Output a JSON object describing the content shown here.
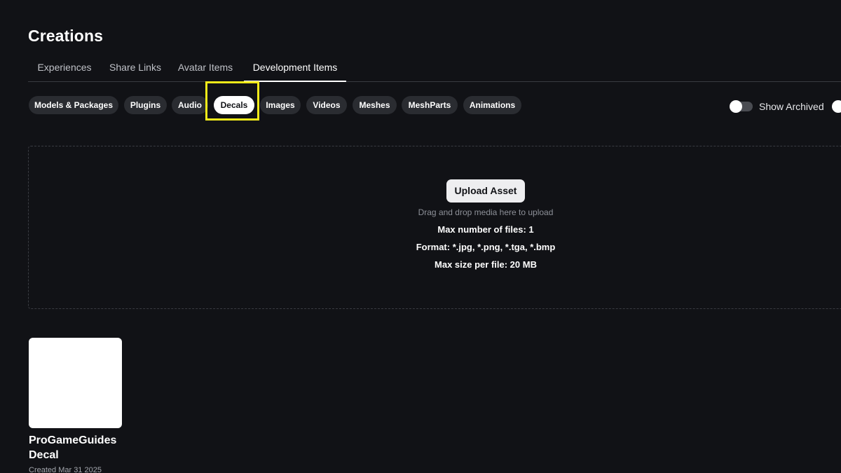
{
  "page_title": "Creations",
  "tabs": [
    {
      "label": "Experiences",
      "active": false
    },
    {
      "label": "Share Links",
      "active": false
    },
    {
      "label": "Avatar Items",
      "active": false
    },
    {
      "label": "Development Items",
      "active": true
    }
  ],
  "filters": [
    {
      "label": "Models & Packages",
      "active": false
    },
    {
      "label": "Plugins",
      "active": false
    },
    {
      "label": "Audio",
      "active": false
    },
    {
      "label": "Decals",
      "active": true
    },
    {
      "label": "Images",
      "active": false
    },
    {
      "label": "Videos",
      "active": false
    },
    {
      "label": "Meshes",
      "active": false
    },
    {
      "label": "MeshParts",
      "active": false
    },
    {
      "label": "Animations",
      "active": false
    }
  ],
  "show_archived": {
    "label": "Show Archived",
    "enabled": false
  },
  "upload": {
    "button_label": "Upload Asset",
    "hint": "Drag and drop media here to upload",
    "max_files": "Max number of files: 1",
    "format": "Format: *.jpg, *.png, *.tga, *.bmp",
    "max_size": "Max size per file: 20 MB"
  },
  "assets": [
    {
      "name": "ProGameGuides Decal",
      "created": "Created Mar 31 2025"
    }
  ],
  "colors": {
    "background": "#111216",
    "chip": "#2a2c31",
    "chip_active": "#ffffff",
    "highlight": "#f2ea19"
  }
}
